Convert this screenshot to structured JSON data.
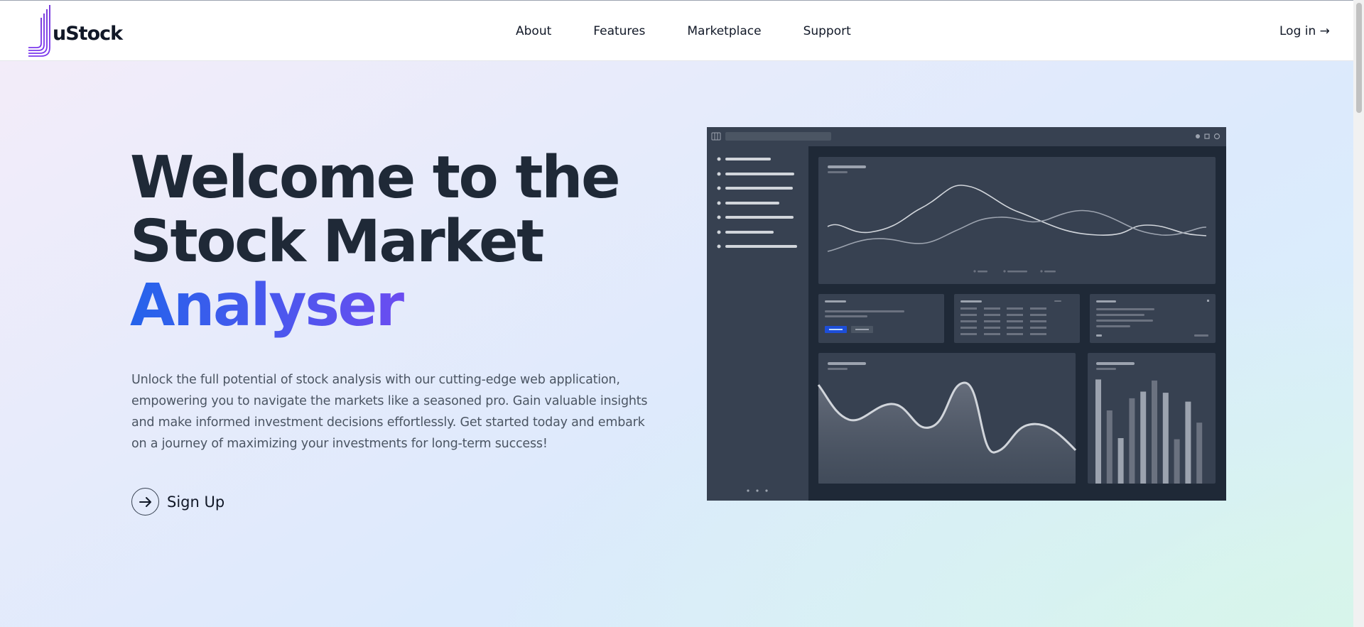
{
  "header": {
    "logo_text": "uStock",
    "nav": [
      "About",
      "Features",
      "Marketplace",
      "Support"
    ],
    "login_label": "Log in →"
  },
  "hero": {
    "title_line1": "Welcome to the",
    "title_line2": "Stock Market",
    "title_accent": "Analyser",
    "description": "Unlock the full potential of stock analysis with our cutting-edge web application, empowering you to navigate the markets like a seasoned pro. Gain valuable insights and make informed investment decisions effortlessly. Get started today and embark on a journey of maximizing your investments for long-term success!",
    "cta_label": "Sign Up",
    "cta_icon": "arrow-right-icon"
  },
  "colors": {
    "accent_start": "#2563eb",
    "accent_end": "#9333ea",
    "mock_background": "#1f2937",
    "mock_card": "#374151"
  },
  "mockup": {
    "bar_chart": {
      "type": "bar",
      "values": [
        0.94,
        0.66,
        0.41,
        0.77,
        0.83,
        0.93,
        0.82,
        0.4,
        0.74,
        0.55
      ]
    }
  }
}
